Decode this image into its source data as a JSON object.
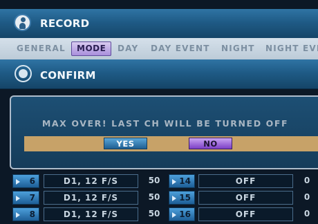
{
  "record_bar": {
    "title": "RECORD",
    "icon": "record-person-icon"
  },
  "tabs": [
    {
      "label": "GENERAL",
      "active": false
    },
    {
      "label": "MODE",
      "active": true
    },
    {
      "label": "DAY",
      "active": false
    },
    {
      "label": "DAY EVENT",
      "active": false
    },
    {
      "label": "NIGHT",
      "active": false
    },
    {
      "label": "NIGHT EVE",
      "active": false
    }
  ],
  "confirm_bar": {
    "title": "CONFIRM",
    "icon": "confirm-circle-icon"
  },
  "dialog": {
    "message": "MAX OVER! LAST CH WILL BE TURNED OFF",
    "yes_label": "YES",
    "no_label": "NO"
  },
  "table": {
    "rows": [
      {
        "left_ch": "6",
        "left_mode": "D1, 12 F/S",
        "left_num": "50",
        "right_ch": "14",
        "right_mode": "OFF",
        "right_num": "0"
      },
      {
        "left_ch": "7",
        "left_mode": "D1, 12 F/S",
        "left_num": "50",
        "right_ch": "15",
        "right_mode": "OFF",
        "right_num": "0"
      },
      {
        "left_ch": "8",
        "left_mode": "D1, 12 F/S",
        "left_num": "50",
        "right_ch": "16",
        "right_mode": "OFF",
        "right_num": "0"
      }
    ]
  },
  "colors": {
    "title_bar": "#1f5b86",
    "active_tab": "#a98fdc",
    "yes_button": "#2f7fb8",
    "no_button": "#8e50d4",
    "button_row": "#c7a268"
  }
}
